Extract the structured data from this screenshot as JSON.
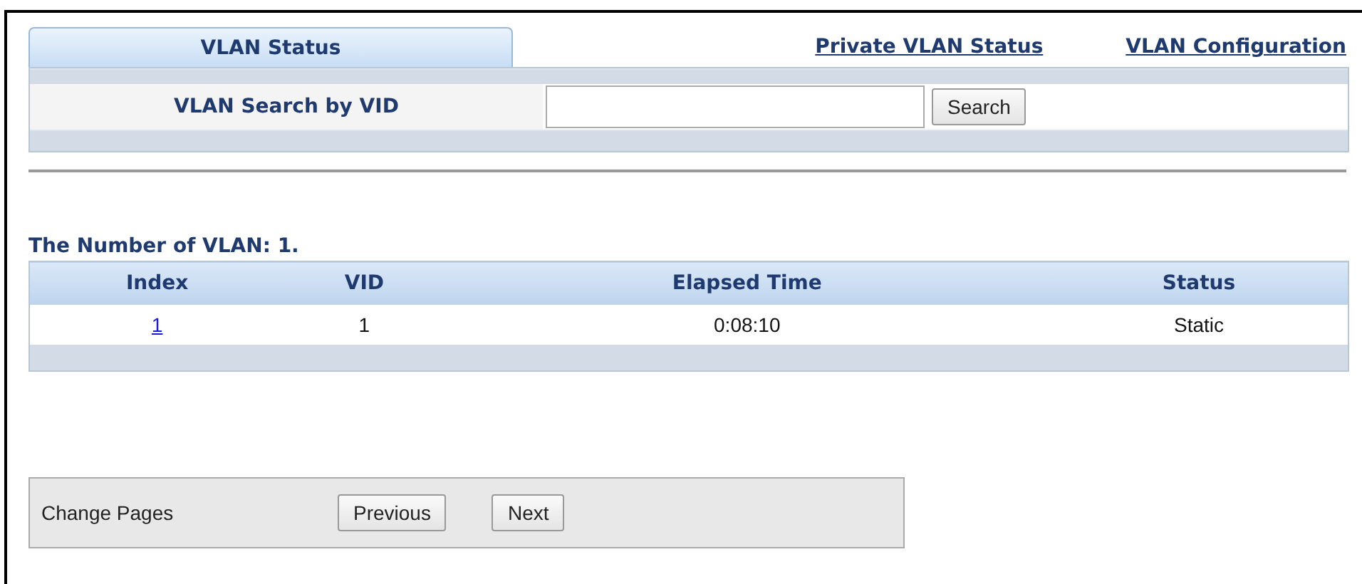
{
  "tabs": [
    {
      "label": "VLAN Status",
      "selected": true
    },
    {
      "label": "Private VLAN Status",
      "selected": false
    },
    {
      "label": "VLAN Configuration",
      "selected": false
    }
  ],
  "search": {
    "label": "VLAN Search by VID",
    "button": "Search"
  },
  "summary": "The Number of VLAN: 1.",
  "table": {
    "columns": [
      "Index",
      "VID",
      "Elapsed Time",
      "Status"
    ],
    "rows": [
      {
        "index": "1",
        "vid": "1",
        "elapsed_time": "0:08:10",
        "status": "Static"
      }
    ]
  },
  "pager": {
    "label": "Change Pages",
    "buttons": [
      "Previous",
      "Next"
    ]
  }
}
